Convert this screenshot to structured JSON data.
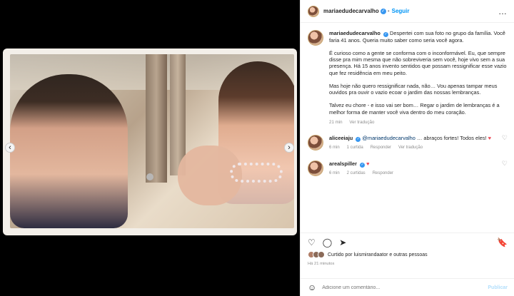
{
  "post": {
    "username": "mariaedudecarvalho",
    "follow": "Seguir",
    "more": "…",
    "caption_p1": "Despertei com sua foto no grupo da família. Você faria 41 anos. Queria muito saber como seria você agora.",
    "caption_p2": "É curioso como a gente se conforma com o inconformável. Eu, que sempre disse pra mim mesma que não sobreviveria sem você, hoje vivo sem a sua presença. Há 15 anos invento sentidos que possam ressignificar esse vazio que fez residência em meu peito.",
    "caption_p3": "Mas hoje não quero ressignificar nada, não… Vou apenas tampar meus ouvidos pra ouvir o vazio ecoar o jardim das nossas lembranças.",
    "caption_p4": "Talvez eu chore - e isso vai ser bom… Regar o jardim de lembranças é a melhor forma de manter você viva dentro do meu coração.",
    "caption_time": "21 min",
    "see_translation": "Ver tradução"
  },
  "comments": [
    {
      "username": "aliceeiaju",
      "mention": "@mariaedudecarvalho",
      "text": "… abraços fortes! Todos eles! ",
      "heart": "♥",
      "time": "6 min",
      "likes": "1 curtida",
      "reply": "Responder",
      "translate": "Ver tradução"
    },
    {
      "username": "arealspiller",
      "text": "",
      "heart": "♥",
      "time": "6 min",
      "likes": "2 curtidas",
      "reply": "Responder"
    }
  ],
  "actions": {
    "like": "♡",
    "comment": "◯",
    "share": "➤",
    "save": "🔖"
  },
  "likes_text": "Curtido por luismirandaator e outras pessoas",
  "time_ago": "Há 21 minutos",
  "comment_box": {
    "emoji": "☺",
    "placeholder": "Adicione um comentário...",
    "post": "Publicar"
  }
}
